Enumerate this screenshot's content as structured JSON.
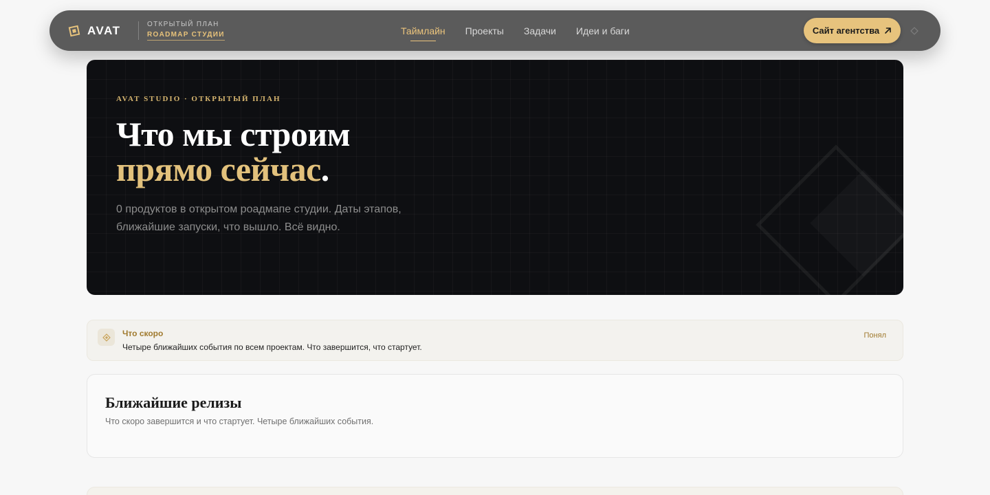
{
  "nav": {
    "brand": "AVAT",
    "sub_line1": "ОТКРЫТЫЙ ПЛАН",
    "sub_line2": "ROADMAP СТУДИИ",
    "links": [
      {
        "label": "Таймлайн",
        "active": true
      },
      {
        "label": "Проекты",
        "active": false
      },
      {
        "label": "Задачи",
        "active": false
      },
      {
        "label": "Идеи и баги",
        "active": false
      }
    ],
    "cta_label": "Сайт агентства",
    "icons": {
      "logo": "diamond-logo-icon",
      "cta_arrow": "arrow-up-right-icon",
      "theme": "diamond-toggle-icon"
    }
  },
  "hero": {
    "eyebrow": "AVAT STUDIO · ОТКРЫТЫЙ ПЛАН",
    "title_line1": "Что мы строим",
    "title_accent": "прямо сейчас",
    "title_dot": ".",
    "description": "0 продуктов в открытом роадмапе студии. Даты этапов, ближайшие запуски, что вышло. Всё видно."
  },
  "notice": {
    "title": "Что скоро",
    "text": "Четыре ближайших события по всем проектам. Что завершится, что стартует.",
    "dismiss_label": "Понял",
    "icon": "diamond-icon"
  },
  "releases": {
    "title": "Ближайшие релизы",
    "subtitle": "Что скоро завершится и что стартует. Четыре ближайших события."
  },
  "colors": {
    "accent": "#e7c37d",
    "nav_bg": "#5b5b5b",
    "hero_bg": "#0e0f12",
    "page_bg": "#f7f7f7"
  }
}
